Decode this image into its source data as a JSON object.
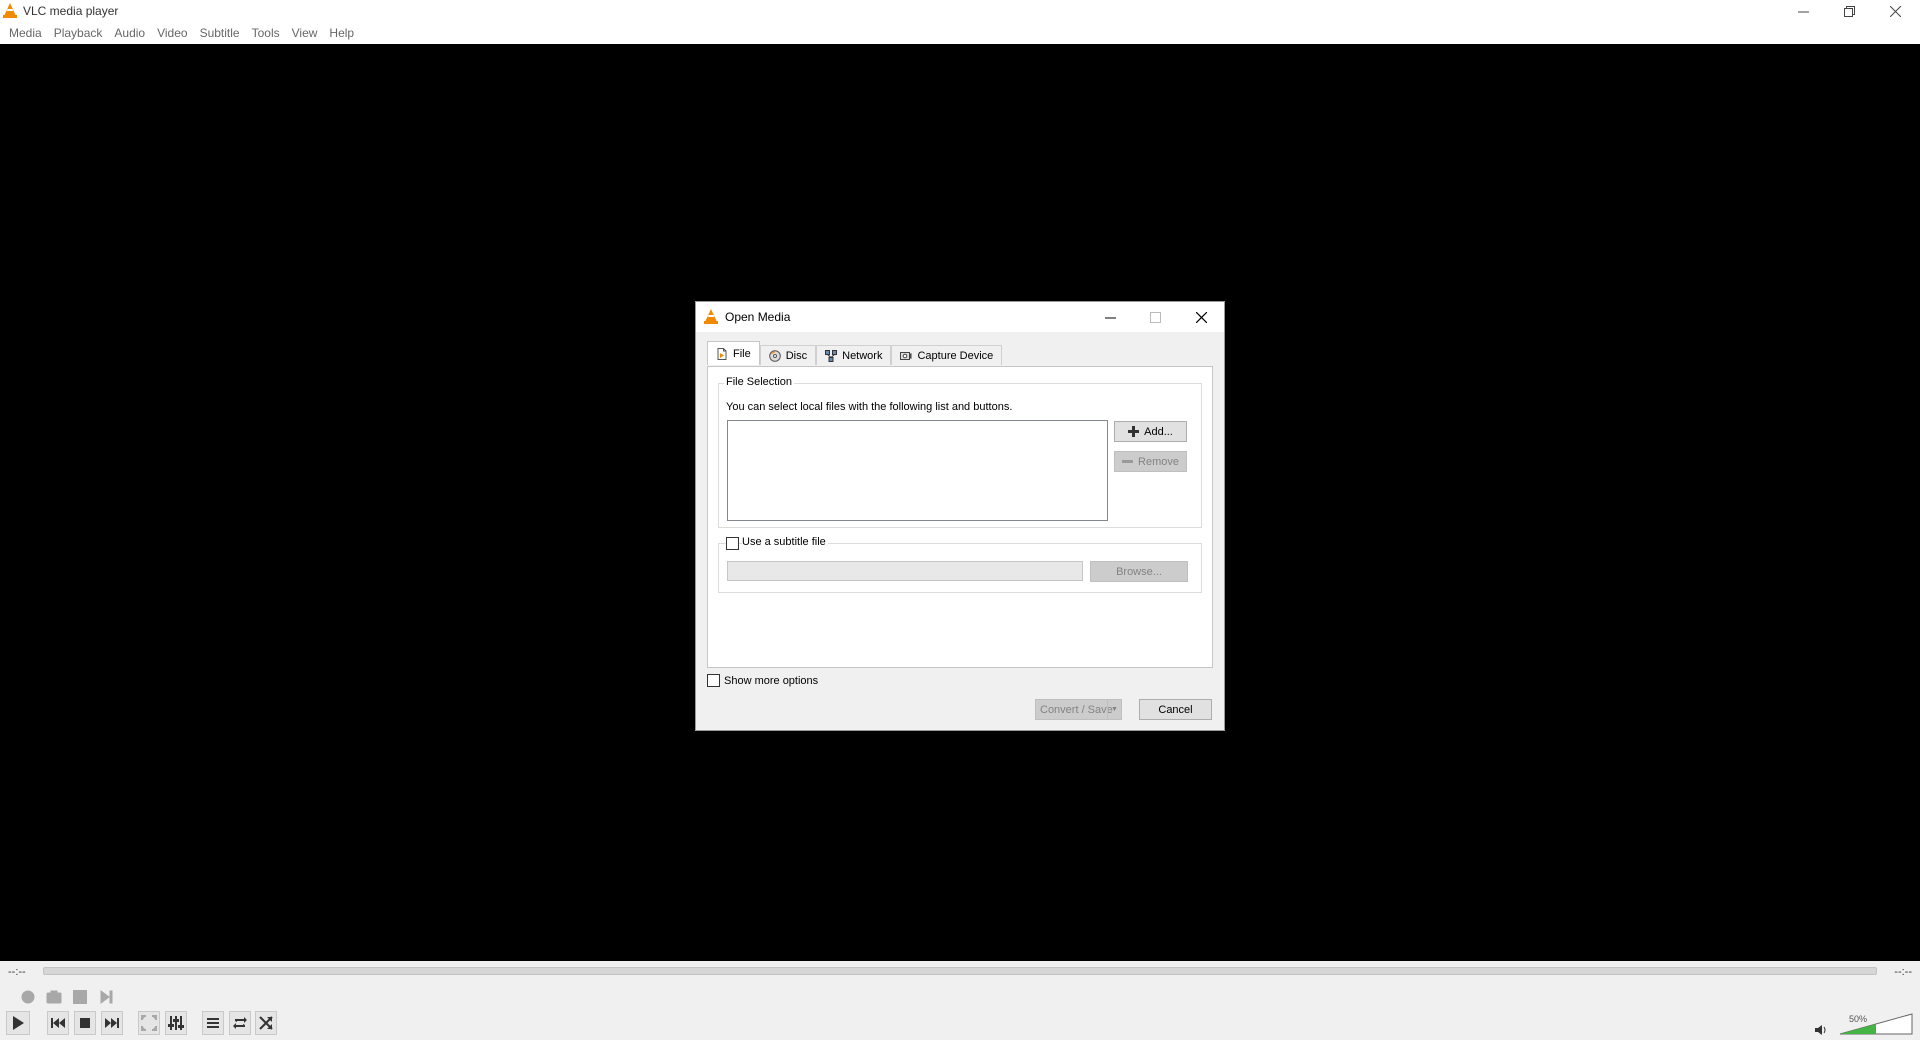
{
  "app": {
    "title": "VLC media player",
    "menu": [
      "Media",
      "Playback",
      "Audio",
      "Video",
      "Subtitle",
      "Tools",
      "View",
      "Help"
    ]
  },
  "player": {
    "time_elapsed": "--:--",
    "time_total": "--:--",
    "volume_label": "50%",
    "volume_level": 0.5
  },
  "dialog": {
    "title": "Open Media",
    "tabs": [
      {
        "label": "File",
        "icon": "file-icon",
        "active": true
      },
      {
        "label": "Disc",
        "icon": "disc-icon",
        "active": false
      },
      {
        "label": "Network",
        "icon": "network-icon",
        "active": false
      },
      {
        "label": "Capture Device",
        "icon": "capture-device-icon",
        "active": false
      }
    ],
    "file_selection": {
      "legend": "File Selection",
      "hint": "You can select local files with the following list and buttons.",
      "files": [],
      "add_label": "Add...",
      "remove_label": "Remove"
    },
    "subtitle": {
      "checkbox_label": "Use a subtitle file",
      "checked": false,
      "path_value": "",
      "browse_label": "Browse..."
    },
    "show_more_label": "Show more options",
    "convert_label": "Convert / Save",
    "cancel_label": "Cancel"
  },
  "colors": {
    "vlc_orange": "#f28a00",
    "video_background": "#000000",
    "volume_green": "#44b444"
  }
}
